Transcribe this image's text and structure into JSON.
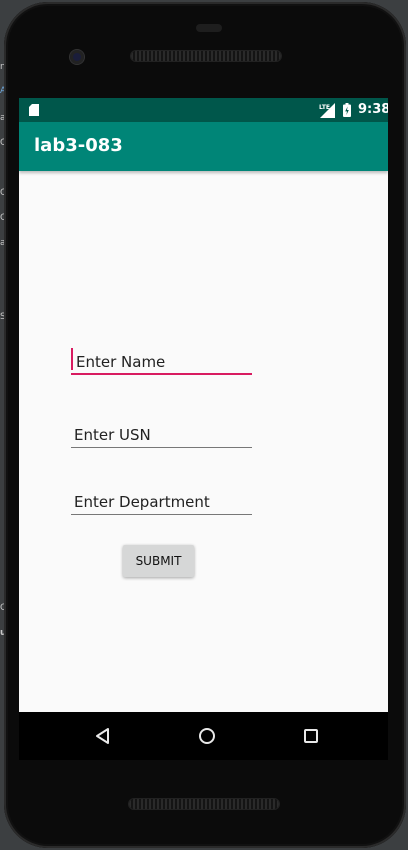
{
  "status_bar": {
    "time": "9:38",
    "network": "LTE",
    "color": "#00574b"
  },
  "app_bar": {
    "title": "lab3-083",
    "color": "#008577"
  },
  "form": {
    "name_placeholder": "Enter Name",
    "usn_placeholder": "Enter USN",
    "department_placeholder": "Enter Department",
    "focused_field": "name",
    "accent_color": "#d81b60",
    "submit_label": "SUBMIT"
  },
  "nav_bar": {
    "buttons": [
      "back-icon",
      "home-icon",
      "recents-icon"
    ]
  },
  "host_strip": {
    "letters": [
      "n",
      "A",
      "a",
      "C",
      "C",
      "C",
      "a",
      "S",
      "C",
      "u"
    ]
  }
}
